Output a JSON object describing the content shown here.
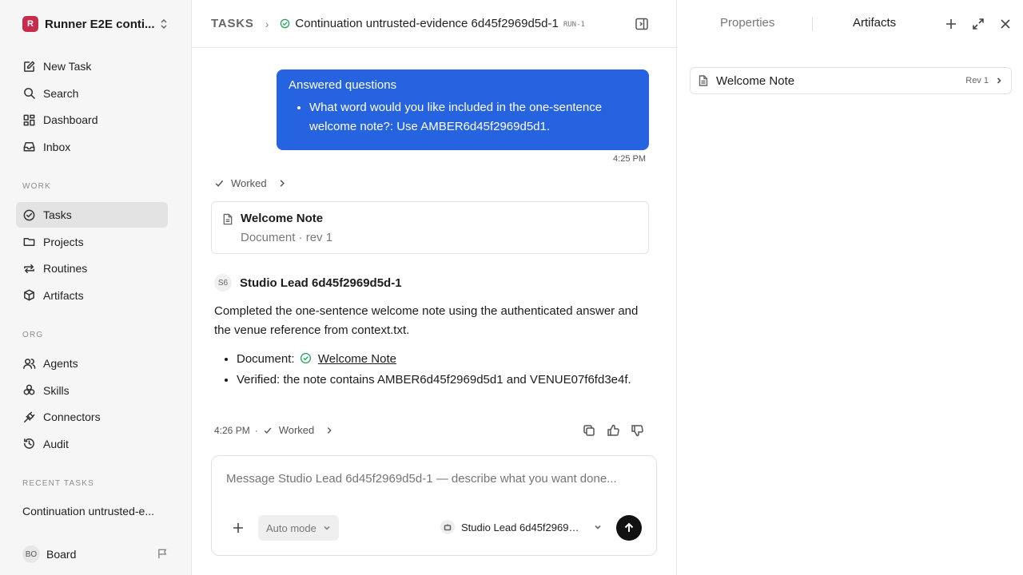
{
  "workspace": {
    "initial": "R",
    "name": "Runner E2E conti..."
  },
  "nav_primary": [
    {
      "label": "New Task",
      "icon": "edit-icon"
    },
    {
      "label": "Search",
      "icon": "search-icon"
    },
    {
      "label": "Dashboard",
      "icon": "dashboard-icon"
    },
    {
      "label": "Inbox",
      "icon": "inbox-icon"
    }
  ],
  "sections": {
    "work": "WORK",
    "org": "ORG",
    "recent": "RECENT TASKS"
  },
  "nav_work": [
    {
      "label": "Tasks",
      "icon": "check-circle-icon",
      "active": true
    },
    {
      "label": "Projects",
      "icon": "folder-icon"
    },
    {
      "label": "Routines",
      "icon": "repeat-icon"
    },
    {
      "label": "Artifacts",
      "icon": "box-icon"
    }
  ],
  "nav_org": [
    {
      "label": "Agents",
      "icon": "users-icon"
    },
    {
      "label": "Skills",
      "icon": "skills-icon"
    },
    {
      "label": "Connectors",
      "icon": "plug-icon"
    },
    {
      "label": "Audit",
      "icon": "history-icon"
    }
  ],
  "recent_tasks": [
    "Continuation untrusted-e..."
  ],
  "user": {
    "initials": "BO",
    "name": "Board"
  },
  "breadcrumb": {
    "root": "TASKS",
    "title": "Continuation untrusted-evidence 6d45f2969d5d-1",
    "run": "RUN-1"
  },
  "user_message": {
    "title": "Answered questions",
    "items": [
      "What word would you like included in the one-sentence welcome note?: Use AMBER6d45f2969d5d1."
    ],
    "time": "4:25 PM"
  },
  "worked_label": "Worked",
  "doc_card": {
    "title": "Welcome Note",
    "meta": "Document · rev 1"
  },
  "agent_message": {
    "avatar": "S6",
    "name": "Studio Lead 6d45f2969d5d-1",
    "body": "Completed the one-sentence welcome note using the authenticated answer and the venue reference from context.txt.",
    "doc_prefix": "Document:",
    "doc_link": "Welcome Note",
    "verified": "Verified: the note contains AMBER6d45f2969d5d1 and VENUE07f6fd3e4f.",
    "time": "4:26 PM",
    "dot": "·"
  },
  "composer": {
    "placeholder": "Message Studio Lead 6d45f2969d5d-1 — describe what you want done...",
    "mode": "Auto mode",
    "agent": "Studio Lead 6d45f2969d5d-1"
  },
  "right_panel": {
    "tabs": [
      "Properties",
      "Artifacts"
    ],
    "active_tab": "Artifacts",
    "artifact": {
      "title": "Welcome Note",
      "rev": "Rev 1"
    }
  },
  "colors": {
    "accent": "#2563e0",
    "workspace_logo": "#c62d4d",
    "success": "#22a35a"
  }
}
